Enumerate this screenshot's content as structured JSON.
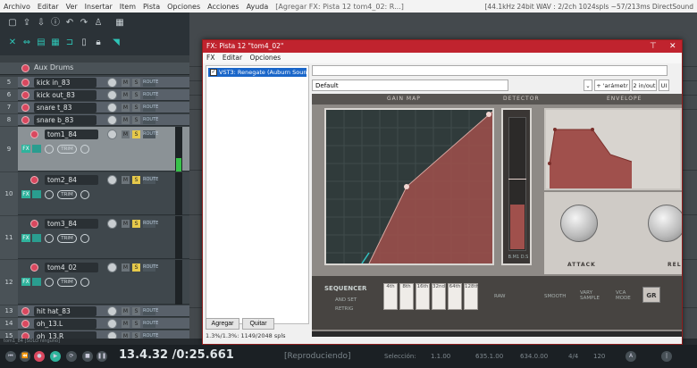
{
  "menubar": {
    "items": [
      "Archivo",
      "Editar",
      "Ver",
      "Insertar",
      "Item",
      "Pista",
      "Opciones",
      "Acciones",
      "Ayuda",
      "[Agregar FX: Pista 12 tom4_02: R...]"
    ],
    "status": "[44.1kHz 24bit WAV : 2/2ch 1024spls ~57/213ms DirectSound"
  },
  "folder": {
    "name": "Aux Drums"
  },
  "tracks": [
    {
      "num": "5",
      "name": "kick in_83"
    },
    {
      "num": "6",
      "name": "kick out_83"
    },
    {
      "num": "7",
      "name": "snare t_83"
    },
    {
      "num": "8",
      "name": "snare b_83"
    },
    {
      "num": "9",
      "name": "tom1_84"
    },
    {
      "num": "10",
      "name": "tom2_84"
    },
    {
      "num": "11",
      "name": "tom3_84"
    },
    {
      "num": "12",
      "name": "tom4_02"
    },
    {
      "num": "13",
      "name": "hit hat_83"
    },
    {
      "num": "14",
      "name": "oh_13.L"
    },
    {
      "num": "15",
      "name": "oh_13.R"
    }
  ],
  "track_buttons": {
    "mute": "M",
    "solo": "S",
    "io": "ROUTE",
    "fx": "FX",
    "trim": "TRIM"
  },
  "fx_window": {
    "title": "FX: Pista 12 \"tom4_02\"",
    "menu": [
      "FX",
      "Editar",
      "Opciones"
    ],
    "plugin_item": "VST3: Renegate (Auburn Sounds)",
    "add_button": "Agregar",
    "remove_button": "Quitar",
    "cpu": "1.3%/1.3%: 1149/2048 spls",
    "preset": "Default",
    "param_button": "+ 'arámetr",
    "io_button": "2 in/out",
    "ui_button": "UI"
  },
  "plugin": {
    "sections": [
      "GAIN MAP",
      "DETECTOR",
      "ENVELOPE"
    ],
    "detector_label": "B.M1 D.S",
    "attack_label": "ATTACK",
    "release_label": "REL",
    "sequencer_label": "SEQUENCER",
    "and_set": "AND SET",
    "retrig": "RETRIG",
    "note_cells": [
      "4th",
      "8th",
      "16th",
      "32nd",
      "64th",
      "128th"
    ],
    "raw": "RAW",
    "smooth": "SMOOTH",
    "vary_sample": "VARY SAMPLE",
    "vca_mode": "VCA MODE",
    "gr": "GR"
  },
  "transport": {
    "time": "13.4.32 /0:25.661",
    "state": "[Reproduciendo]",
    "selection_label": "Selección:",
    "sel_start": "1.1.00",
    "sel_end": "635.1.00",
    "sel_len": "634.0.00",
    "sig": "4/4",
    "tempo": "120"
  },
  "subbar": "tom1_84 [SOLO ninguno]",
  "colors": {
    "accent": "#c0232e",
    "teal": "#2fb39c",
    "solo": "#e6c94b",
    "rec": "#d9485f"
  }
}
